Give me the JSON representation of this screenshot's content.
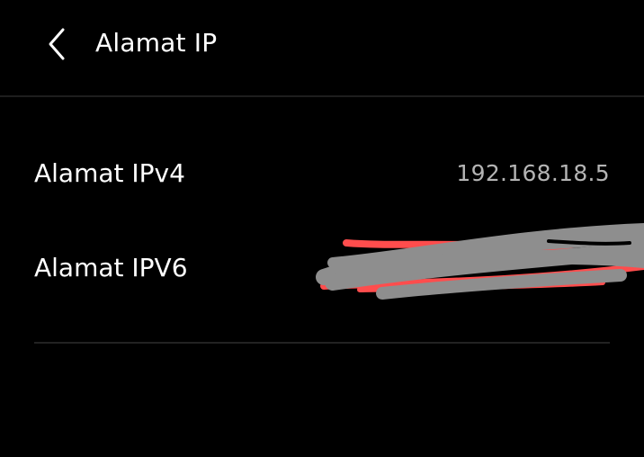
{
  "header": {
    "back_icon": "chevron-left-icon",
    "title": "Alamat IP"
  },
  "rows": [
    {
      "label": "Alamat IPv4",
      "value": "192.168.18.5"
    },
    {
      "label": "Alamat IPV6",
      "value": ""
    }
  ],
  "redaction": {
    "present": true,
    "colors": [
      "#ff4d4d",
      "#8e8e8e"
    ]
  },
  "colors": {
    "background": "#000000",
    "primary_text": "#ffffff",
    "secondary_text": "#b4b4b4",
    "divider": "#222222"
  }
}
